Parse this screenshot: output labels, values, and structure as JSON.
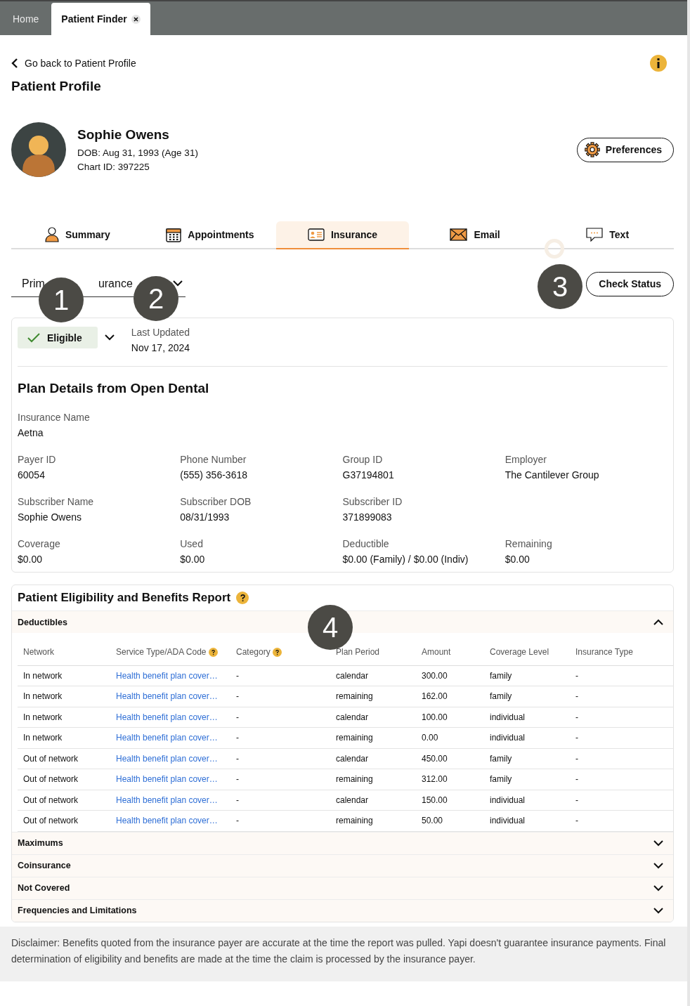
{
  "top_tabs": [
    {
      "label": "Home",
      "selected": false,
      "closable": false
    },
    {
      "label": "Patient Finder",
      "selected": true,
      "closable": true
    }
  ],
  "back_link": "Go back to Patient Profile",
  "page_title": "Patient Profile",
  "patient": {
    "name": "Sophie Owens",
    "dob_label": "DOB:",
    "dob": "Aug 31, 1993 (Age 31)",
    "chart_label": "Chart ID:",
    "chart_id": "397225"
  },
  "preferences_button": "Preferences",
  "tabs": [
    {
      "label": "Summary",
      "kind": "person",
      "selected": false
    },
    {
      "label": "Appointments",
      "kind": "calendar",
      "selected": false
    },
    {
      "label": "Insurance",
      "kind": "card",
      "selected": true
    },
    {
      "label": "Email",
      "kind": "envelope",
      "selected": false
    },
    {
      "label": "Text",
      "kind": "chat",
      "selected": false
    }
  ],
  "insurance_select": {
    "visible_text": [
      "Prim",
      "urance"
    ]
  },
  "check_status_button": "Check Status",
  "eligibility": {
    "status": "Eligible",
    "updated_label": "Last Updated",
    "updated": "Nov 17, 2024"
  },
  "plan_details": {
    "title": "Plan Details from Open Dental",
    "rows": [
      [
        {
          "label": "Insurance Name",
          "value": "Aetna"
        }
      ],
      [
        {
          "label": "Payer ID",
          "value": "60054"
        },
        {
          "label": "Phone Number",
          "value": "(555) 356-3618"
        },
        {
          "label": "Group ID",
          "value": "G37194801"
        },
        {
          "label": "Employer",
          "value": "The Cantilever Group"
        }
      ],
      [
        {
          "label": "Subscriber Name",
          "value": "Sophie Owens"
        },
        {
          "label": "Subscriber DOB",
          "value": "08/31/1993"
        },
        {
          "label": "Subscriber ID",
          "value": "371899083"
        }
      ],
      [
        {
          "label": "Coverage",
          "value": "$0.00"
        },
        {
          "label": "Used",
          "value": "$0.00"
        },
        {
          "label": "Deductible",
          "value": "$0.00 (Family) / $0.00 (Indiv)"
        },
        {
          "label": "Remaining",
          "value": "$0.00"
        }
      ]
    ]
  },
  "report": {
    "title": "Patient Eligibility and Benefits Report",
    "sections": [
      {
        "title": "Deductibles",
        "expanded": true,
        "table": {
          "columns": [
            {
              "label": "Network",
              "help": false
            },
            {
              "label": "Service Type/ADA Code",
              "help": true
            },
            {
              "label": "Category",
              "help": true
            },
            {
              "label": "Plan Period",
              "help": false
            },
            {
              "label": "Amount",
              "help": false
            },
            {
              "label": "Coverage Level",
              "help": false
            },
            {
              "label": "Insurance Type",
              "help": false
            }
          ],
          "rows": [
            [
              "In network",
              "Health benefit plan cover…",
              "-",
              "calendar",
              "300.00",
              "family",
              "-"
            ],
            [
              "In network",
              "Health benefit plan cover…",
              "-",
              "remaining",
              "162.00",
              "family",
              "-"
            ],
            [
              "In network",
              "Health benefit plan cover…",
              "-",
              "calendar",
              "100.00",
              "individual",
              "-"
            ],
            [
              "In network",
              "Health benefit plan cover…",
              "-",
              "remaining",
              "0.00",
              "individual",
              "-"
            ],
            [
              "Out of network",
              "Health benefit plan cover…",
              "-",
              "calendar",
              "450.00",
              "family",
              "-"
            ],
            [
              "Out of network",
              "Health benefit plan cover…",
              "-",
              "remaining",
              "312.00",
              "family",
              "-"
            ],
            [
              "Out of network",
              "Health benefit plan cover…",
              "-",
              "calendar",
              "150.00",
              "individual",
              "-"
            ],
            [
              "Out of network",
              "Health benefit plan cover…",
              "-",
              "remaining",
              "50.00",
              "individual",
              "-"
            ]
          ]
        }
      },
      {
        "title": "Maximums",
        "expanded": false
      },
      {
        "title": "Coinsurance",
        "expanded": false
      },
      {
        "title": "Not Covered",
        "expanded": false
      },
      {
        "title": "Frequencies and Limitations",
        "expanded": false
      }
    ]
  },
  "disclaimer": "Disclaimer: Benefits quoted from the insurance payer are accurate at the time the report was pulled. Yapi doesn't guarantee insurance payments. Final determination of eligibility and benefits are made at the time the claim is processed by the insurance payer.",
  "markers": [
    "1",
    "2",
    "3",
    "4"
  ]
}
